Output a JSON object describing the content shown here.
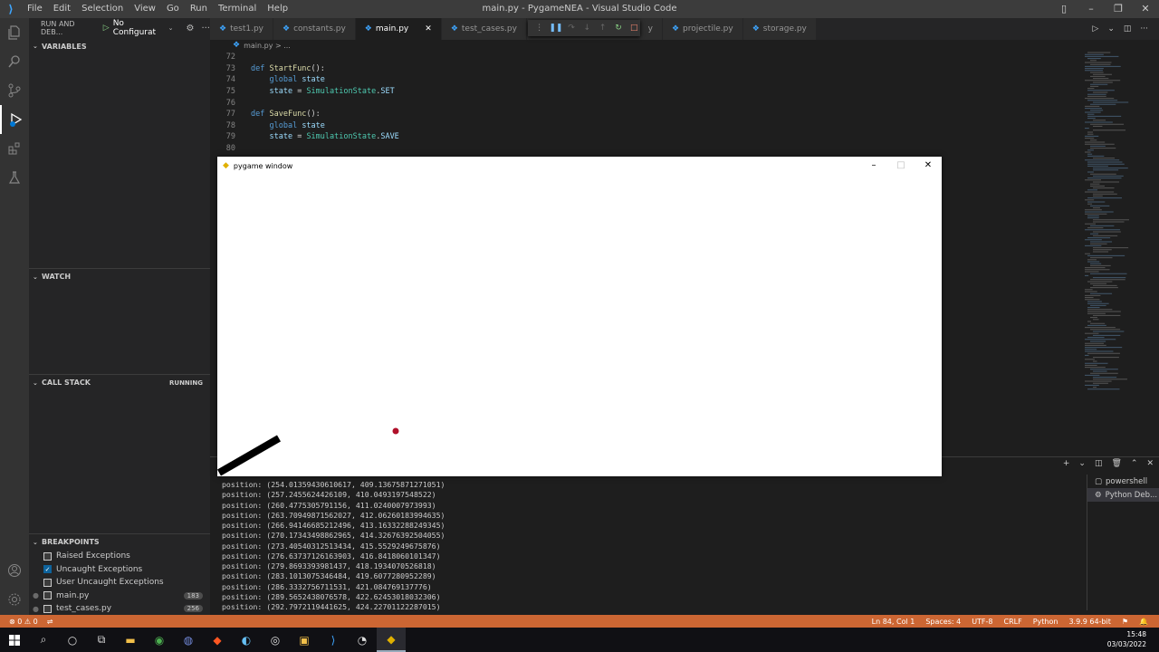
{
  "titlebar": {
    "menu": [
      "File",
      "Edit",
      "Selection",
      "View",
      "Go",
      "Run",
      "Terminal",
      "Help"
    ],
    "title": "main.py - PygameNEA - Visual Studio Code"
  },
  "sidebar": {
    "header": "RUN AND DEB...",
    "config": "No Configurat",
    "sections": {
      "variables": "VARIABLES",
      "watch": "WATCH",
      "callstack": "CALL STACK",
      "callstack_status": "RUNNING",
      "breakpoints": "BREAKPOINTS"
    },
    "breakpoints": [
      {
        "label": "Raised Exceptions",
        "checked": false
      },
      {
        "label": "Uncaught Exceptions",
        "checked": true
      },
      {
        "label": "User Uncaught Exceptions",
        "checked": false
      }
    ],
    "files": [
      {
        "label": "main.py",
        "count": "183"
      },
      {
        "label": "test_cases.py",
        "count": "256"
      }
    ]
  },
  "tabs": [
    {
      "label": "test1.py",
      "active": false
    },
    {
      "label": "constants.py",
      "active": false
    },
    {
      "label": "main.py",
      "active": true
    },
    {
      "label": "test_cases.py",
      "active": false
    },
    {
      "label": "y",
      "active": false
    },
    {
      "label": "projectile.py",
      "active": false
    },
    {
      "label": "storage.py",
      "active": false
    }
  ],
  "breadcrumb": "main.py > ...",
  "code": [
    {
      "n": "72",
      "t": []
    },
    {
      "n": "73",
      "t": [
        [
          "kw",
          "def "
        ],
        [
          "fn",
          "StartFunc"
        ],
        [
          "plain",
          "():"
        ]
      ]
    },
    {
      "n": "74",
      "t": [
        [
          "plain",
          "    "
        ],
        [
          "kw",
          "global "
        ],
        [
          "var",
          "state"
        ]
      ]
    },
    {
      "n": "75",
      "t": [
        [
          "plain",
          "    "
        ],
        [
          "var",
          "state"
        ],
        [
          "plain",
          " = "
        ],
        [
          "cls",
          "SimulationState"
        ],
        [
          "plain",
          "."
        ],
        [
          "var",
          "SET"
        ]
      ]
    },
    {
      "n": "76",
      "t": []
    },
    {
      "n": "77",
      "t": [
        [
          "kw",
          "def "
        ],
        [
          "fn",
          "SaveFunc"
        ],
        [
          "plain",
          "():"
        ]
      ]
    },
    {
      "n": "78",
      "t": [
        [
          "plain",
          "    "
        ],
        [
          "kw",
          "global "
        ],
        [
          "var",
          "state"
        ]
      ]
    },
    {
      "n": "79",
      "t": [
        [
          "plain",
          "    "
        ],
        [
          "var",
          "state"
        ],
        [
          "plain",
          " = "
        ],
        [
          "cls",
          "SimulationState"
        ],
        [
          "plain",
          "."
        ],
        [
          "var",
          "SAVE"
        ]
      ]
    },
    {
      "n": "80",
      "t": []
    }
  ],
  "pygame": {
    "title": "pygame window"
  },
  "terminal": {
    "lines": [
      "position: (254.01359430610617, 409.13675871271051)",
      "position: (257.2455624426109, 410.0493197548522)",
      "position: (260.4775305791156, 411.0240007973993)",
      "position: (263.7094987156202​7, 412.06260183994635)",
      "position: (266.94146685212496, 413.16332288249345)",
      "position: (270.17343498862965, 414.32676392504055)",
      "position: (273.40540312513434, 415.5529249675876)",
      "position: (276.63737126163903, 416.8418060101347)",
      "position: (279.8693393981437, 418.1934070526818)",
      "position: (283.1013075346484, 419.6077280952289)",
      "position: (286.3332756711531, 421.084769137776)",
      "position: (289.5652438076578, 422.62453018032306)",
      "position: (292.7972119441625, 424.22701122287015)"
    ],
    "sessions": [
      "powershell",
      "Python Deb..."
    ]
  },
  "status": {
    "left": "⊗ 0 ⚠ 0",
    "items": [
      "Ln 84, Col 1",
      "Spaces: 4",
      "UTF-8",
      "CRLF",
      "Python",
      "3.9.9 64-bit"
    ]
  },
  "clock": {
    "time": "15:48",
    "date": "03/03/2022"
  },
  "colors": {
    "status_bar": "#cc6633",
    "projectile": "#b0102a"
  }
}
